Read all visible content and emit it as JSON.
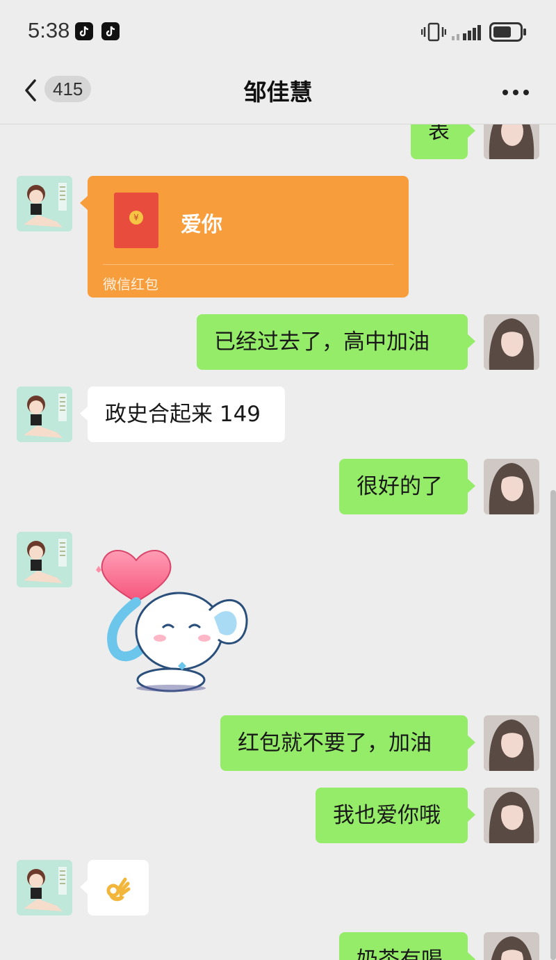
{
  "status_bar": {
    "time": "5:38",
    "battery_level": 0.7
  },
  "header": {
    "unread_count": "415",
    "title": "邹佳慧"
  },
  "messages": [
    {
      "from": "me",
      "text": "表"
    },
    {
      "from": "them",
      "type": "red_packet",
      "text": "爱你",
      "label": "微信红包"
    },
    {
      "from": "me",
      "text": "已经过去了，高中加油"
    },
    {
      "from": "them",
      "text": "政史合起来 149"
    },
    {
      "from": "me",
      "text": "很好的了"
    },
    {
      "from": "them",
      "type": "sticker",
      "sticker": "elephant-heart-sticker"
    },
    {
      "from": "me",
      "text": "红包就不要了，加油"
    },
    {
      "from": "me",
      "text": "我也爱你哦"
    },
    {
      "from": "them",
      "type": "emoji",
      "text": "👌"
    },
    {
      "from": "me",
      "text": "奶茶有喝"
    }
  ],
  "colors": {
    "background": "#ededed",
    "my_bubble": "#95ec69",
    "their_bubble": "#ffffff",
    "red_packet": "#f89d3b"
  }
}
